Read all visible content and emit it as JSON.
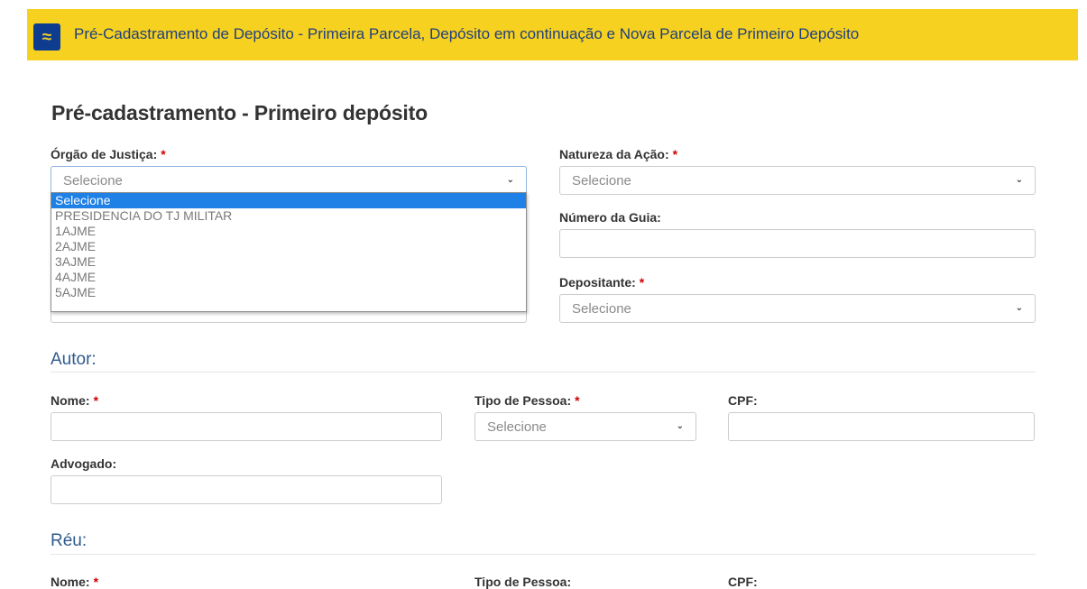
{
  "header": {
    "title": "Pré-Cadastramento de Depósito - Primeira Parcela, Depósito em continuação e Nova Parcela de Primeiro Depósito",
    "background": "#f7d11f"
  },
  "page": {
    "title": "Pré-cadastramento - Primeiro depósito"
  },
  "form": {
    "orgao": {
      "label": "Órgão de Justiça:",
      "required": "*",
      "value": "Selecione",
      "options": [
        "Selecione",
        "PRESIDENCIA DO TJ MILITAR",
        "1AJME",
        "2AJME",
        "3AJME",
        "4AJME",
        "5AJME"
      ]
    },
    "natureza": {
      "label": "Natureza da Ação:",
      "required": "*",
      "value": "Selecione"
    },
    "numero_guia": {
      "label": "Número da Guia:",
      "value": ""
    },
    "depositante": {
      "label": "Depositante:",
      "required": "*",
      "value": "Selecione"
    }
  },
  "autor": {
    "title": "Autor:",
    "nome": {
      "label": "Nome:",
      "required": "*",
      "value": ""
    },
    "tipo_pessoa": {
      "label": "Tipo de Pessoa:",
      "required": "*",
      "value": "Selecione"
    },
    "cpf": {
      "label": "CPF:",
      "value": ""
    },
    "advogado": {
      "label": "Advogado:",
      "value": ""
    }
  },
  "reu": {
    "title": "Réu:",
    "nome": {
      "label": "Nome:",
      "required": "*"
    },
    "tipo_pessoa": {
      "label": "Tipo de Pessoa:"
    },
    "cpf": {
      "label": "CPF:"
    }
  },
  "colors": {
    "accent": "#1f80e6",
    "section": "#2f5b8e",
    "required": "#d10000"
  }
}
